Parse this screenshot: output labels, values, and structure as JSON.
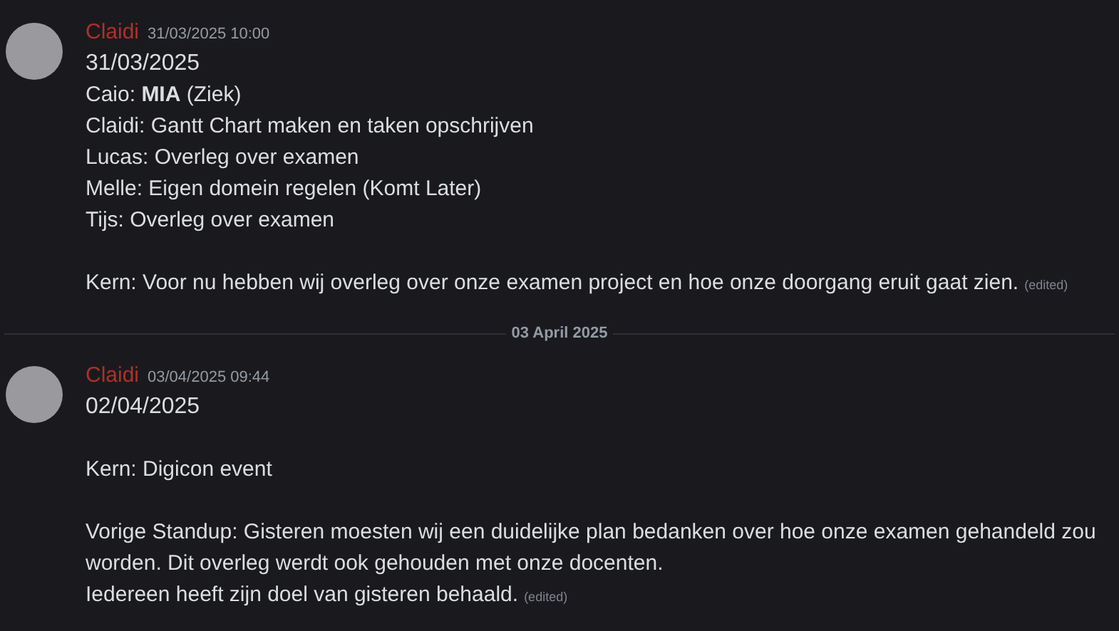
{
  "messages": [
    {
      "author": "Claidi",
      "timestamp": "31/03/2025 10:00",
      "edited": "(edited)",
      "paragraphs": [
        {
          "lines": [
            {
              "text": "31/03/2025",
              "large": true
            },
            {
              "text": "Caio: **MIA** (Ziek)",
              "large": false
            },
            {
              "text": "Claidi: Gantt Chart maken en taken opschrijven",
              "large": false
            },
            {
              "text": "Lucas: Overleg over examen",
              "large": false
            },
            {
              "text": "Melle: Eigen domein regelen (Komt Later)",
              "large": false
            },
            {
              "text": "Tijs: Overleg over examen",
              "large": false
            }
          ]
        },
        {
          "lines": [
            {
              "text": "Kern: Voor nu hebben wij overleg over onze examen project en hoe onze doorgang eruit gaat zien.",
              "large": false
            }
          ]
        }
      ]
    },
    {
      "divider": "03 April 2025",
      "author": "Claidi",
      "timestamp": "03/04/2025 09:44",
      "edited": "(edited)",
      "paragraphs": [
        {
          "lines": [
            {
              "text": "02/04/2025",
              "large": true
            }
          ]
        },
        {
          "lines": [
            {
              "text": "Kern: Digicon event",
              "large": false
            }
          ]
        },
        {
          "lines": [
            {
              "text": "Vorige Standup: Gisteren moesten wij een duidelijke plan bedanken over hoe onze examen gehandeld zou worden. Dit overleg werdt ook gehouden met onze docenten.",
              "large": false
            },
            {
              "text": "Iedereen heeft zijn doel van gisteren behaald.",
              "large": false
            }
          ]
        }
      ]
    }
  ]
}
